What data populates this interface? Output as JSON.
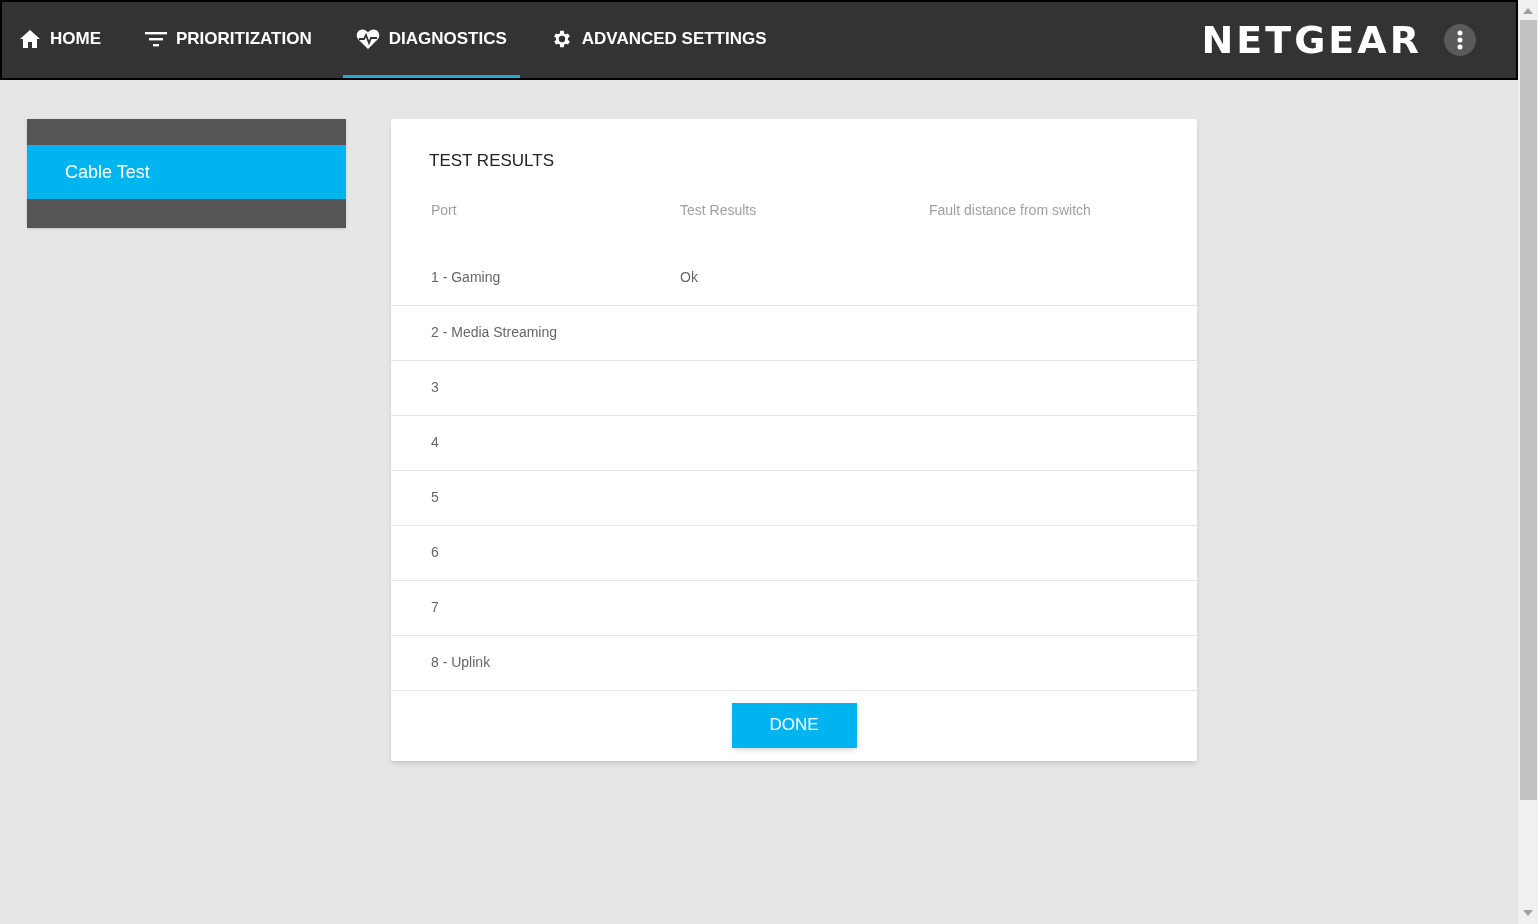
{
  "nav": {
    "tabs": [
      {
        "label": "HOME",
        "selected": false
      },
      {
        "label": "PRIORITIZATION",
        "selected": false
      },
      {
        "label": "DIAGNOSTICS",
        "selected": true
      },
      {
        "label": "ADVANCED SETTINGS",
        "selected": false
      }
    ],
    "logo": "NETGEAR"
  },
  "sidebar": {
    "items": [
      {
        "label": "Cable Test",
        "selected": true
      }
    ]
  },
  "panel": {
    "title": "TEST RESULTS",
    "columns": [
      "Port",
      "Test Results",
      "Fault distance from switch"
    ],
    "rows": [
      [
        "1 - Gaming",
        "Ok",
        ""
      ],
      [
        "2 - Media Streaming",
        "",
        ""
      ],
      [
        "3",
        "",
        ""
      ],
      [
        "4",
        "",
        ""
      ],
      [
        "5",
        "",
        ""
      ],
      [
        "6",
        "",
        ""
      ],
      [
        "7",
        "",
        ""
      ],
      [
        "8 - Uplink",
        "",
        ""
      ]
    ],
    "button": "DONE"
  }
}
